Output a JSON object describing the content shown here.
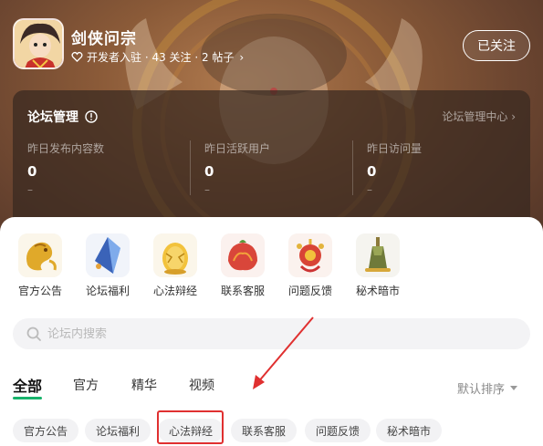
{
  "header": {
    "game_name": "剑侠问宗",
    "meta_text": "开发者入驻 · 43 关注 · 2 帖子",
    "follow_label": "已关注"
  },
  "admin": {
    "title": "论坛管理",
    "center_link": "论坛管理中心 ›",
    "stats": [
      {
        "label": "昨日发布内容数",
        "value": "0",
        "delta": "–"
      },
      {
        "label": "昨日活跃用户",
        "value": "0",
        "delta": "–"
      },
      {
        "label": "昨日访问量",
        "value": "0",
        "delta": "–"
      }
    ]
  },
  "categories": [
    {
      "label": "官方公告",
      "icon": "golden-dragon-icon"
    },
    {
      "label": "论坛福利",
      "icon": "blue-crystal-icon"
    },
    {
      "label": "心法辩经",
      "icon": "golden-egg-icon"
    },
    {
      "label": "联系客服",
      "icon": "red-fruit-icon"
    },
    {
      "label": "问题反馈",
      "icon": "red-bell-icon"
    },
    {
      "label": "秘术暗市",
      "icon": "bronze-bell-icon"
    }
  ],
  "search": {
    "placeholder": "论坛内搜索"
  },
  "tabs": [
    "全部",
    "官方",
    "精华",
    "视频"
  ],
  "sort_label": "默认排序",
  "chips": [
    "官方公告",
    "论坛福利",
    "心法辩经",
    "联系客服",
    "问题反馈",
    "秘术暗市"
  ],
  "colors": {
    "accent": "#18b36b",
    "highlight": "#e03030"
  }
}
